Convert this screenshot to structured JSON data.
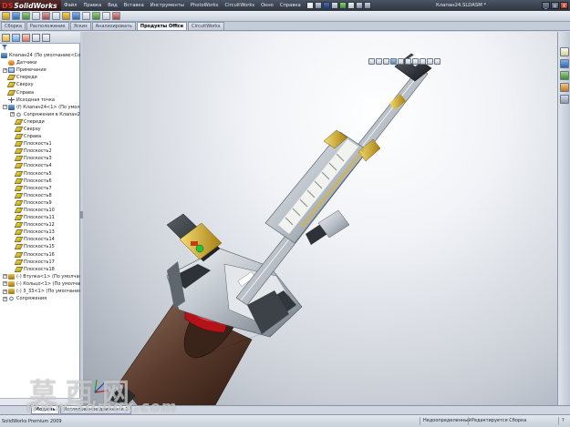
{
  "app": {
    "logo_ds": "DS",
    "logo_name": "SolidWorks"
  },
  "menu": [
    "Файл",
    "Правка",
    "Вид",
    "Вставка",
    "Инструменты",
    "PhotoWorks",
    "CircuitWorks",
    "Окно",
    "Справка"
  ],
  "document_title": "Клапан24.SLDASM *",
  "window_buttons": [
    "_",
    "▫",
    "x"
  ],
  "command_tabs": [
    {
      "label": "Сборка",
      "active": false
    },
    {
      "label": "Расположение",
      "active": false
    },
    {
      "label": "Эскиз",
      "active": false
    },
    {
      "label": "Анализировать",
      "active": false
    },
    {
      "label": "Продукты Office",
      "active": true
    },
    {
      "label": "CircuitWorks",
      "active": false
    }
  ],
  "feature_tree": {
    "root": "Клапан24 (По умолчанию<Состо",
    "rows": [
      {
        "label": "Датчики",
        "icon": "sensor",
        "indent": 1,
        "expander": ""
      },
      {
        "label": "Примечания",
        "icon": "note",
        "indent": 1,
        "expander": "+"
      },
      {
        "label": "Спереди",
        "icon": "plane",
        "indent": 1,
        "expander": ""
      },
      {
        "label": "Сверху",
        "icon": "plane",
        "indent": 1,
        "expander": ""
      },
      {
        "label": "Справа",
        "icon": "plane",
        "indent": 1,
        "expander": ""
      },
      {
        "label": "Исходная точка",
        "icon": "origin",
        "indent": 1,
        "expander": ""
      },
      {
        "label": "(f) Клапан24<1> (По умолчан",
        "icon": "asm",
        "indent": 1,
        "expander": "−"
      },
      {
        "label": "Сопряжения в Клапан24",
        "icon": "mate",
        "indent": 2,
        "expander": "+"
      },
      {
        "label": "Спереди",
        "icon": "plane",
        "indent": 2,
        "expander": ""
      },
      {
        "label": "Сверху",
        "icon": "plane",
        "indent": 2,
        "expander": ""
      },
      {
        "label": "Справа",
        "icon": "plane",
        "indent": 2,
        "expander": ""
      },
      {
        "label": "Плоскость1",
        "icon": "plane",
        "indent": 2,
        "expander": ""
      },
      {
        "label": "Плоскость2",
        "icon": "plane",
        "indent": 2,
        "expander": ""
      },
      {
        "label": "Плоскость3",
        "icon": "plane",
        "indent": 2,
        "expander": ""
      },
      {
        "label": "Плоскость4",
        "icon": "plane",
        "indent": 2,
        "expander": ""
      },
      {
        "label": "Плоскость5",
        "icon": "plane",
        "indent": 2,
        "expander": ""
      },
      {
        "label": "Плоскость6",
        "icon": "plane",
        "indent": 2,
        "expander": ""
      },
      {
        "label": "Плоскость7",
        "icon": "plane",
        "indent": 2,
        "expander": ""
      },
      {
        "label": "Плоскость8",
        "icon": "plane",
        "indent": 2,
        "expander": ""
      },
      {
        "label": "Плоскость9",
        "icon": "plane",
        "indent": 2,
        "expander": ""
      },
      {
        "label": "Плоскость10",
        "icon": "plane",
        "indent": 2,
        "expander": ""
      },
      {
        "label": "Плоскость11",
        "icon": "plane",
        "indent": 2,
        "expander": ""
      },
      {
        "label": "Плоскость12",
        "icon": "plane",
        "indent": 2,
        "expander": ""
      },
      {
        "label": "Плоскость13",
        "icon": "plane",
        "indent": 2,
        "expander": ""
      },
      {
        "label": "Плоскость14",
        "icon": "plane",
        "indent": 2,
        "expander": ""
      },
      {
        "label": "Плоскость15",
        "icon": "plane",
        "indent": 2,
        "expander": ""
      },
      {
        "label": "Плоскость16",
        "icon": "plane",
        "indent": 2,
        "expander": ""
      },
      {
        "label": "Плоскость17",
        "icon": "plane",
        "indent": 2,
        "expander": ""
      },
      {
        "label": "Плоскость18",
        "icon": "plane",
        "indent": 2,
        "expander": ""
      },
      {
        "label": "(-) Втулка<1> (По умолчани",
        "icon": "part",
        "indent": 1,
        "expander": "+"
      },
      {
        "label": "(-) Кольцо<1> (По умолчани",
        "icon": "part",
        "indent": 1,
        "expander": "+"
      },
      {
        "label": "(-) 3_33<1> (По умолчанию",
        "icon": "part",
        "indent": 1,
        "expander": "+"
      },
      {
        "label": "Сопряжения",
        "icon": "mate",
        "indent": 1,
        "expander": "+"
      }
    ]
  },
  "bottom_tabs": [
    {
      "label": "Модель",
      "active": true
    },
    {
      "label": "Исследование движения 1",
      "active": false
    }
  ],
  "status": {
    "left": "SolidWorks Premium 2009",
    "definition": "Недоопределенный",
    "mode": "Редактируется Сборка",
    "help": "?"
  },
  "watermark": {
    "cn": "莫西网",
    "en": "www.3dmox.com"
  },
  "colors": {
    "accent_red": "#c0161c",
    "housing": "#5a3a2c",
    "steel": "#b9c0c8",
    "brass": "#d9b43a"
  }
}
